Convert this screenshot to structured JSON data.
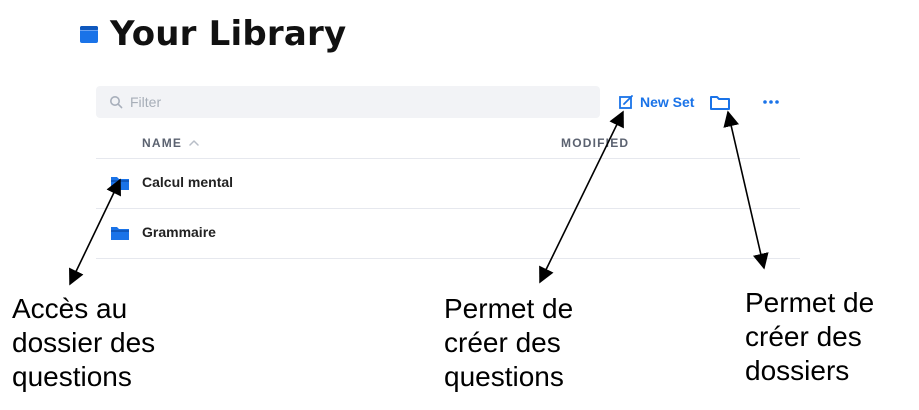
{
  "header": {
    "title": "Your Library",
    "icon": "book-icon",
    "accent_color": "#1a73e8"
  },
  "filter": {
    "placeholder": "Filter",
    "value": "",
    "icon": "search-icon"
  },
  "toolbar": {
    "new_set_label": "New Set",
    "new_set_icon": "edit-icon",
    "new_folder_icon": "folder-icon",
    "more_icon": "more-icon"
  },
  "table": {
    "columns": [
      {
        "label": "NAME",
        "sort": "ascending",
        "sort_icon": "chevron-up-icon"
      },
      {
        "label": "MODIFIED"
      }
    ],
    "rows": [
      {
        "name": "Calcul mental",
        "icon": "folder-icon"
      },
      {
        "name": "Grammaire",
        "icon": "folder-icon"
      }
    ]
  },
  "annotations": {
    "folders_access": "Accès au\ndossier des\nquestions",
    "create_questions": "Permet de\ncréer des\nquestions",
    "create_folders": "Permet de\ncréer des\ndossiers"
  }
}
